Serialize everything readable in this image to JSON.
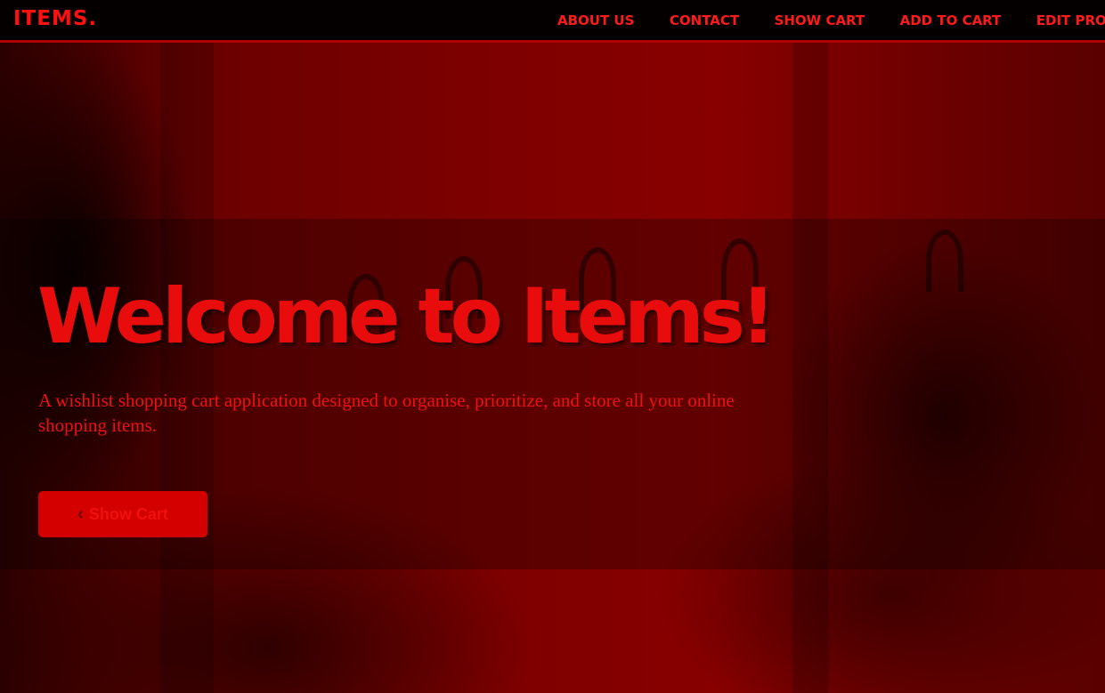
{
  "header": {
    "brand": "ITEMS.",
    "nav": [
      {
        "label": "ABOUT US"
      },
      {
        "label": "CONTACT"
      },
      {
        "label": "SHOW CART"
      },
      {
        "label": "ADD TO CART"
      },
      {
        "label": "EDIT PROFILE"
      }
    ]
  },
  "hero": {
    "title": "Welcome to Items!",
    "subtitle": "A wishlist shopping cart application designed to organise, prioritize, and store all your online shopping items.",
    "cta_label": "Show Cart",
    "cta_icon": "chevron-left-icon"
  },
  "colors": {
    "accent": "#e80c0c",
    "button_bg": "#d40000",
    "nav_bg": "#050000"
  }
}
